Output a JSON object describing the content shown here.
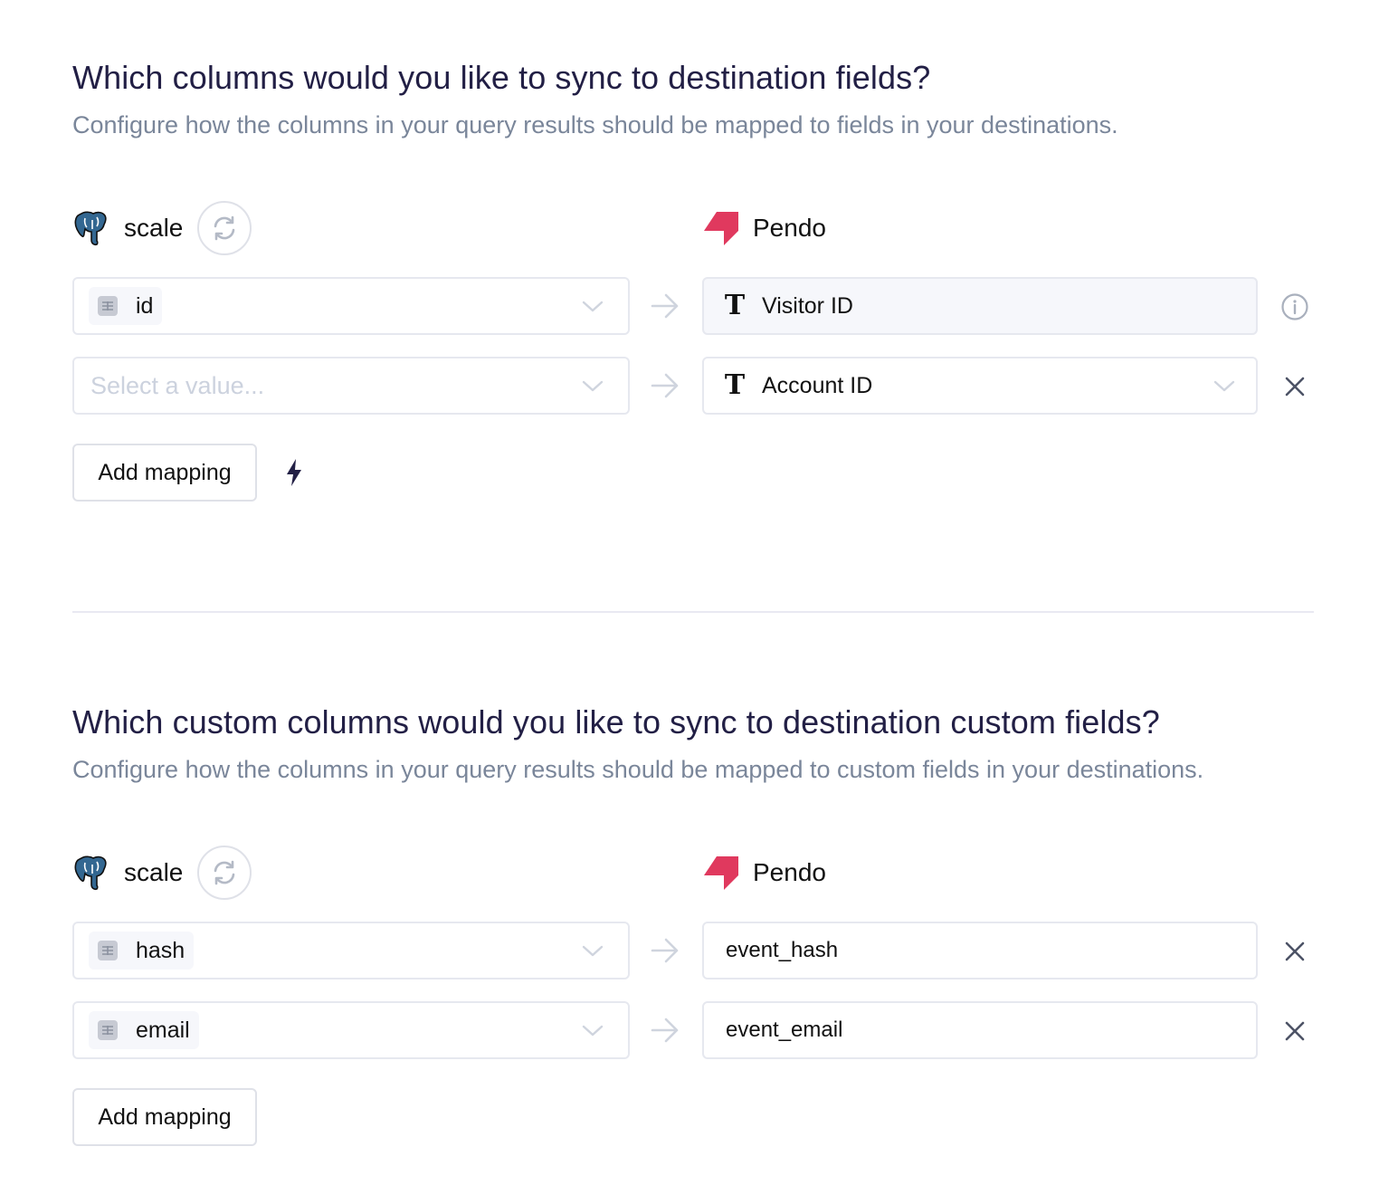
{
  "colors": {
    "title": "#221f45",
    "subtitle": "#7a869a",
    "border": "#e6e8ef",
    "pendo_brand": "#e0395e",
    "postgres_blue": "#336791",
    "icon_gray": "#a9b0bd",
    "close_icon": "#4d5366",
    "bolt": "#221f45"
  },
  "sections": [
    {
      "title": "Which columns would you like to sync to destination fields?",
      "subtitle": "Configure how the columns in your query results should be mapped to fields in your destinations.",
      "source": {
        "name": "scale",
        "icon": "postgres-elephant-icon",
        "refresh_icon": "refresh-icon"
      },
      "destination": {
        "name": "Pendo",
        "icon": "pendo-logo-icon"
      },
      "mappings": [
        {
          "source_value": "id",
          "source_icon": "column-icon",
          "placeholder": "",
          "dest_type_icon": "text-type-icon",
          "dest_value": "Visitor ID",
          "dest_locked": true,
          "action_icon": "info-icon"
        },
        {
          "source_value": "",
          "source_icon": "",
          "placeholder": "Select a value...",
          "dest_type_icon": "text-type-icon",
          "dest_value": "Account ID",
          "dest_locked": false,
          "action_icon": "close-icon"
        }
      ],
      "add_button": "Add mapping",
      "extra_icon": "lightning-bolt-icon"
    },
    {
      "title": "Which custom columns would you like to sync to destination custom fields?",
      "subtitle": "Configure how the columns in your query results should be mapped to custom fields in your destinations.",
      "source": {
        "name": "scale",
        "icon": "postgres-elephant-icon",
        "refresh_icon": "refresh-icon"
      },
      "destination": {
        "name": "Pendo",
        "icon": "pendo-logo-icon"
      },
      "mappings": [
        {
          "source_value": "hash",
          "source_icon": "column-icon",
          "dest_value": "event_hash",
          "action_icon": "close-icon"
        },
        {
          "source_value": "email",
          "source_icon": "column-icon",
          "dest_value": "event_email",
          "action_icon": "close-icon"
        }
      ],
      "add_button": "Add mapping"
    }
  ]
}
